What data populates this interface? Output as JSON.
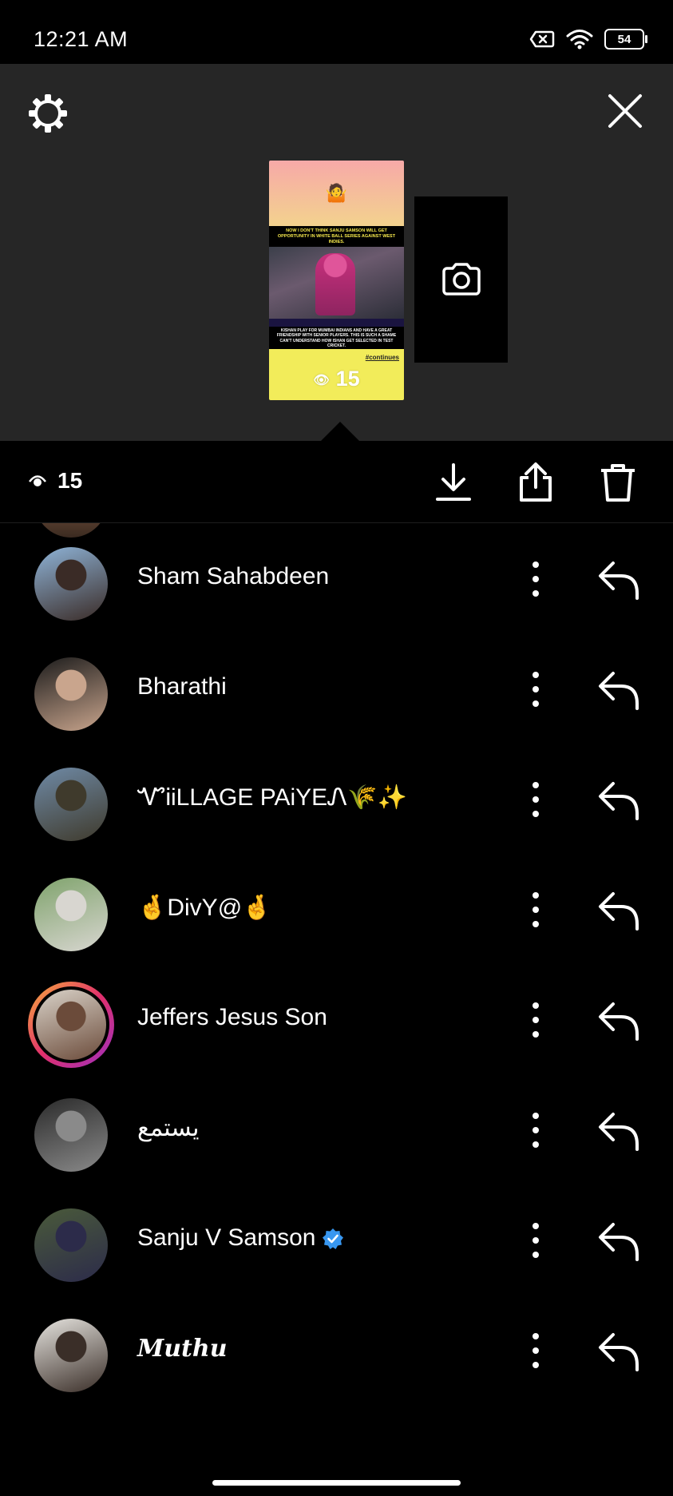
{
  "status_bar": {
    "time": "12:21 AM",
    "battery": "54"
  },
  "story": {
    "headline": "NOW I DON'T THINK SANJU SAMSON WILL GET OPPORTUNITY IN WHITE BALL SERIES AGAINST WEST INDIES.",
    "caption": "KISHAN PLAY FOR MUMBAI INDIANS AND HAVE A GREAT FRIENDSHIP WITH SENIOR PLAYERS. THIS IS SUCH A SHAME CAN'T UNDERSTAND HOW ISHAN GET SELECTED IN TEST CRICKET.",
    "continues": "#continues",
    "views": "15",
    "emoji_top": "🤷"
  },
  "action_bar": {
    "view_count": "15"
  },
  "viewers": [
    {
      "name": "Sham Sahabdeen",
      "avatar_colors": [
        "#8fb4d8",
        "#3a2b26"
      ],
      "ring": false,
      "verified": false,
      "script": false
    },
    {
      "name": "Bharathi",
      "avatar_colors": [
        "#1b1b1b",
        "#c9a58d"
      ],
      "ring": false,
      "verified": false,
      "script": false
    },
    {
      "name": "ᏉᎥiLLAGE PAiYEᏁ🌾✨",
      "avatar_colors": [
        "#6f8aa6",
        "#3f3a2c"
      ],
      "ring": false,
      "verified": false,
      "script": false
    },
    {
      "name": "🤞DivY@🤞",
      "avatar_colors": [
        "#7fa36c",
        "#d8d6d0"
      ],
      "ring": false,
      "verified": false,
      "script": false
    },
    {
      "name": "Jeffers Jesus Son",
      "avatar_colors": [
        "#d9d2c8",
        "#6b4b3a"
      ],
      "ring": true,
      "verified": false,
      "script": false
    },
    {
      "name": "يستمع",
      "avatar_colors": [
        "#2a2a2a",
        "#8a8a8a"
      ],
      "ring": false,
      "verified": false,
      "script": false
    },
    {
      "name": "Sanju V Samson",
      "avatar_colors": [
        "#4a5a3a",
        "#2c2b4a"
      ],
      "ring": false,
      "verified": true,
      "script": false
    },
    {
      "name": "Muthu",
      "avatar_colors": [
        "#e6e4df",
        "#3a2e28"
      ],
      "ring": false,
      "verified": false,
      "script": true
    }
  ],
  "colors": {
    "viewer_bg": "#262626",
    "verified_blue": "#3897f0",
    "story_yellow": "#f2ec5a"
  }
}
